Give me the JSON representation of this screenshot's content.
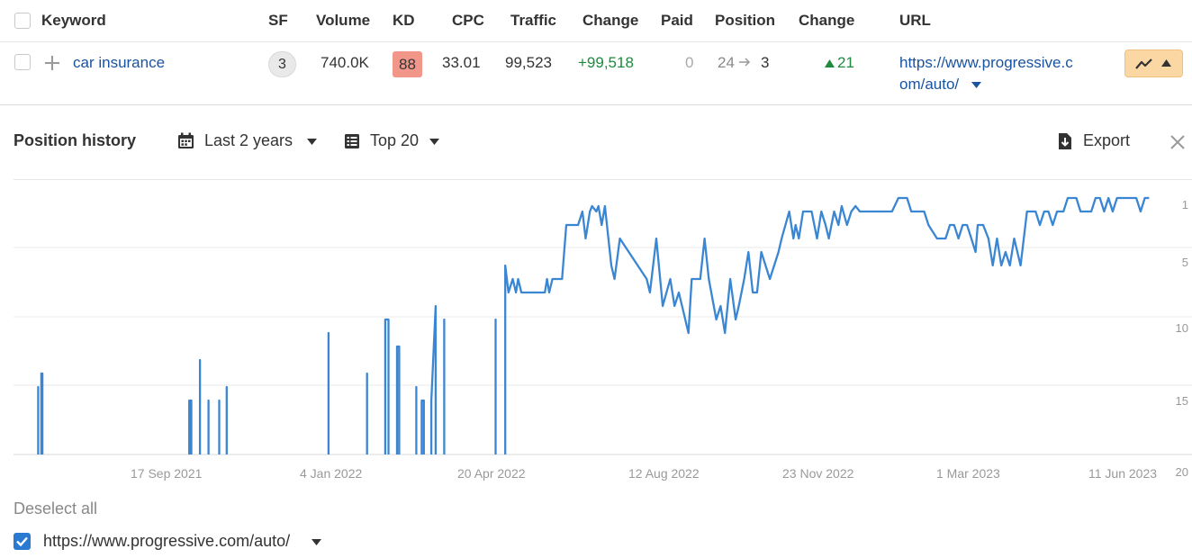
{
  "table": {
    "headers": {
      "keyword": "Keyword",
      "sf": "SF",
      "volume": "Volume",
      "kd": "KD",
      "cpc": "CPC",
      "traffic": "Traffic",
      "change": "Change",
      "paid": "Paid",
      "position": "Position",
      "change2": "Change",
      "url": "URL"
    },
    "row": {
      "keyword": "car insurance",
      "sf": "3",
      "volume": "740.0K",
      "kd": "88",
      "cpc": "33.01",
      "traffic": "99,523",
      "traffic_change": "+99,518",
      "paid": "0",
      "position_from": "24",
      "position_to": "3",
      "position_change": "21",
      "url_line1": "https://www.progressive.c",
      "url_line2": "om/auto/"
    }
  },
  "panel": {
    "title": "Position history",
    "date_range": "Last 2 years",
    "top_filter": "Top 20",
    "export_label": "Export"
  },
  "legend": {
    "deselect_all": "Deselect all",
    "series_url": "https://www.progressive.com/auto/"
  },
  "colors": {
    "series": "#3b86d2",
    "positive": "#1e8a3e",
    "link": "#1a53a0",
    "kd_badge": "#f3968a"
  },
  "chart_data": {
    "type": "line",
    "y_axis": {
      "ticks": [
        "1",
        "5",
        "10",
        "15",
        "20"
      ],
      "reversed": true,
      "ylim": [
        1,
        20
      ]
    },
    "x_axis": {
      "ticks": [
        "17 Sep 2021",
        "4 Jan 2022",
        "20 Apr 2022",
        "12 Aug 2022",
        "23 Nov 2022",
        "1 Mar 2023",
        "11 Jun 2023"
      ]
    },
    "grid": true,
    "series": [
      {
        "values": [
          [
            0.02,
            null
          ],
          [
            0.023,
            15
          ],
          [
            0.024,
            null
          ],
          [
            0.026,
            14
          ],
          [
            0.027,
            14
          ],
          [
            0.028,
            null
          ],
          [
            0.163,
            null
          ],
          [
            0.164,
            16
          ],
          [
            0.166,
            16
          ],
          [
            0.167,
            null
          ],
          [
            0.173,
            null
          ],
          [
            0.174,
            13
          ],
          [
            0.175,
            null
          ],
          [
            0.181,
            null
          ],
          [
            0.182,
            16
          ],
          [
            0.183,
            null
          ],
          [
            0.19,
            null
          ],
          [
            0.192,
            16
          ],
          [
            0.193,
            null
          ],
          [
            0.197,
            null
          ],
          [
            0.199,
            15
          ],
          [
            0.2,
            null
          ],
          [
            0.293,
            null
          ],
          [
            0.294,
            11
          ],
          [
            0.295,
            null
          ],
          [
            0.329,
            null
          ],
          [
            0.33,
            14
          ],
          [
            0.331,
            null
          ],
          [
            0.346,
            null
          ],
          [
            0.347,
            10
          ],
          [
            0.348,
            10
          ],
          [
            0.35,
            10
          ],
          [
            0.351,
            null
          ],
          [
            0.357,
            null
          ],
          [
            0.358,
            12
          ],
          [
            0.36,
            12
          ],
          [
            0.361,
            null
          ],
          [
            0.375,
            null
          ],
          [
            0.376,
            15
          ],
          [
            0.377,
            null
          ],
          [
            0.38,
            null
          ],
          [
            0.381,
            16
          ],
          [
            0.383,
            16
          ],
          [
            0.384,
            null
          ],
          [
            0.389,
            null
          ],
          [
            0.39,
            16
          ],
          [
            0.394,
            9
          ],
          [
            0.395,
            null
          ],
          [
            0.401,
            null
          ],
          [
            0.402,
            10
          ],
          [
            0.403,
            null
          ],
          [
            0.449,
            null
          ],
          [
            0.45,
            10
          ],
          [
            0.451,
            null
          ],
          [
            0.458,
            null
          ],
          [
            0.459,
            6
          ],
          [
            0.462,
            8
          ],
          [
            0.466,
            7
          ],
          [
            0.469,
            8
          ],
          [
            0.471,
            7
          ],
          [
            0.474,
            8
          ],
          [
            0.49,
            8
          ],
          [
            0.496,
            8
          ],
          [
            0.498,
            7
          ],
          [
            0.5,
            8
          ],
          [
            0.503,
            7
          ],
          [
            0.512,
            7
          ],
          [
            0.516,
            3
          ],
          [
            0.527,
            3
          ],
          [
            0.531,
            2
          ],
          [
            0.534,
            4
          ],
          [
            0.538,
            2
          ],
          [
            0.54,
            1.6
          ],
          [
            0.544,
            2
          ],
          [
            0.546,
            1.6
          ],
          [
            0.549,
            3
          ],
          [
            0.552,
            1.6
          ],
          [
            0.558,
            6
          ],
          [
            0.561,
            7
          ],
          [
            0.566,
            4
          ],
          [
            0.591,
            7
          ],
          [
            0.594,
            8
          ],
          [
            0.6,
            4
          ],
          [
            0.606,
            9
          ],
          [
            0.613,
            7
          ],
          [
            0.617,
            9
          ],
          [
            0.621,
            8
          ],
          [
            0.624,
            9
          ],
          [
            0.63,
            11
          ],
          [
            0.633,
            7
          ],
          [
            0.641,
            7
          ],
          [
            0.645,
            4
          ],
          [
            0.649,
            7
          ],
          [
            0.656,
            10
          ],
          [
            0.66,
            9
          ],
          [
            0.664,
            11
          ],
          [
            0.669,
            7
          ],
          [
            0.674,
            10
          ],
          [
            0.677,
            9
          ],
          [
            0.682,
            7
          ],
          [
            0.686,
            5
          ],
          [
            0.69,
            8
          ],
          [
            0.694,
            8
          ],
          [
            0.698,
            5
          ],
          [
            0.706,
            7
          ],
          [
            0.714,
            5
          ],
          [
            0.717,
            4
          ],
          [
            0.724,
            2
          ],
          [
            0.728,
            4
          ],
          [
            0.73,
            3
          ],
          [
            0.733,
            4
          ],
          [
            0.737,
            2
          ],
          [
            0.745,
            2
          ],
          [
            0.75,
            4
          ],
          [
            0.754,
            2
          ],
          [
            0.758,
            3
          ],
          [
            0.761,
            4
          ],
          [
            0.766,
            2
          ],
          [
            0.77,
            3
          ],
          [
            0.773,
            1.6
          ],
          [
            0.778,
            3
          ],
          [
            0.782,
            2
          ],
          [
            0.786,
            1.6
          ],
          [
            0.79,
            2
          ],
          [
            0.802,
            2
          ],
          [
            0.81,
            2
          ],
          [
            0.814,
            2
          ],
          [
            0.82,
            2
          ],
          [
            0.826,
            1
          ],
          [
            0.834,
            1
          ],
          [
            0.838,
            2
          ],
          [
            0.843,
            2
          ],
          [
            0.85,
            2
          ],
          [
            0.854,
            3
          ],
          [
            0.862,
            4
          ],
          [
            0.87,
            4
          ],
          [
            0.874,
            3
          ],
          [
            0.878,
            3
          ],
          [
            0.882,
            4
          ],
          [
            0.886,
            3
          ],
          [
            0.89,
            3
          ],
          [
            0.894,
            4
          ],
          [
            0.898,
            5
          ],
          [
            0.9,
            3
          ],
          [
            0.905,
            3
          ],
          [
            0.91,
            4
          ],
          [
            0.914,
            6
          ],
          [
            0.918,
            4
          ],
          [
            0.922,
            6
          ],
          [
            0.926,
            5
          ],
          [
            0.93,
            6
          ],
          [
            0.934,
            4
          ],
          [
            0.94,
            6
          ],
          [
            0.946,
            2
          ],
          [
            0.95,
            2
          ],
          [
            0.954,
            2
          ],
          [
            0.958,
            3
          ],
          [
            0.962,
            2
          ],
          [
            0.966,
            2
          ],
          [
            0.97,
            3
          ],
          [
            0.974,
            2
          ],
          [
            0.98,
            2
          ],
          [
            0.984,
            1
          ],
          [
            0.992,
            1
          ],
          [
            0.996,
            2
          ],
          [
            1.0,
            2
          ],
          [
            1.006,
            2
          ],
          [
            1.01,
            1
          ],
          [
            1.014,
            1
          ],
          [
            1.018,
            2
          ],
          [
            1.022,
            1
          ],
          [
            1.026,
            2
          ],
          [
            1.03,
            1
          ],
          [
            1.034,
            1
          ],
          [
            1.048,
            1
          ],
          [
            1.052,
            2
          ],
          [
            1.056,
            1
          ],
          [
            1.06,
            1
          ]
        ]
      }
    ]
  }
}
